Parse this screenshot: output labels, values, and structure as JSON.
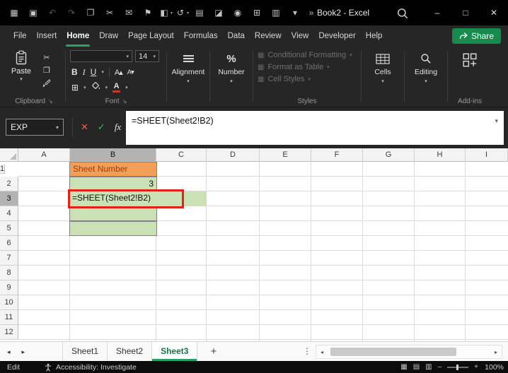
{
  "colors": {
    "accent_green": "#178A4E",
    "tab_underline": "#2EA266",
    "sheet_underline": "#21A366",
    "cell_orange_bg": "#F2A057",
    "cell_orange_text": "#9C3A12",
    "cell_green_bg": "#C9E1B5",
    "annotation_red": "#E32119"
  },
  "icons": {
    "chevron": "▾",
    "launcher": "↘",
    "qat": [
      "▦",
      "▣",
      "↶",
      "↷",
      "❐",
      "✂",
      "✉",
      "⚑",
      "◧",
      "↺",
      "▤",
      "◪",
      "◉",
      "⊞",
      "▥",
      "▾"
    ],
    "overflow": "»",
    "win_min": "–",
    "win_max": "□",
    "win_close": "✕",
    "cut": "✂",
    "copy": "❐",
    "bold": "B",
    "italic": "I",
    "underline": "U",
    "grow_font": "A▴",
    "shrink_font": "A▾",
    "borders": "⊞",
    "percent": "%",
    "font_color": "A",
    "styles_item": "▦",
    "cancel": "✕",
    "enter": "✓",
    "fx": "fx",
    "plus": "+",
    "dots": "⋮",
    "nav_left": "◂",
    "nav_right": "▸",
    "view_normal": "▦",
    "view_layout": "▤",
    "view_break": "▥",
    "zoom_out": "–",
    "zoom_in": "+"
  },
  "titlebar": {
    "title": "Book2  -  Excel"
  },
  "ribbon": {
    "tabs": [
      "File",
      "Insert",
      "Home",
      "Draw",
      "Page Layout",
      "Formulas",
      "Data",
      "Review",
      "View",
      "Developer",
      "Help"
    ],
    "active_tab": "Home",
    "share": "Share",
    "paste": "Paste",
    "font_name": "",
    "font_size": "14",
    "alignment": "Alignment",
    "number": "Number",
    "styles_items": [
      "Conditional Formatting",
      "Format as Table",
      "Cell Styles"
    ],
    "cells": "Cells",
    "editing": "Editing",
    "addins": "Add-ins",
    "group_labels": {
      "clipboard": "Clipboard",
      "font": "Font",
      "styles": "Styles",
      "addins": "Add-ins"
    }
  },
  "formula_bar": {
    "name_box": "EXP",
    "formula": "=SHEET(Sheet2!B2)"
  },
  "grid": {
    "columns": [
      "A",
      "B",
      "C",
      "D",
      "E",
      "F",
      "G",
      "H",
      "I"
    ],
    "rows": [
      "1",
      "2",
      "3",
      "4",
      "5",
      "6",
      "7",
      "8",
      "9",
      "10",
      "11",
      "12"
    ],
    "active_column": "B",
    "active_row": "3",
    "cells": {
      "B1": "Sheet Number",
      "B2": "3",
      "B3": "=SHEET(Sheet2!B2)"
    }
  },
  "sheet_bar": {
    "tabs": [
      "Sheet1",
      "Sheet2",
      "Sheet3"
    ],
    "active": "Sheet3"
  },
  "status_bar": {
    "mode": "Edit",
    "accessibility": "Accessibility: Investigate",
    "zoom": "100%"
  }
}
